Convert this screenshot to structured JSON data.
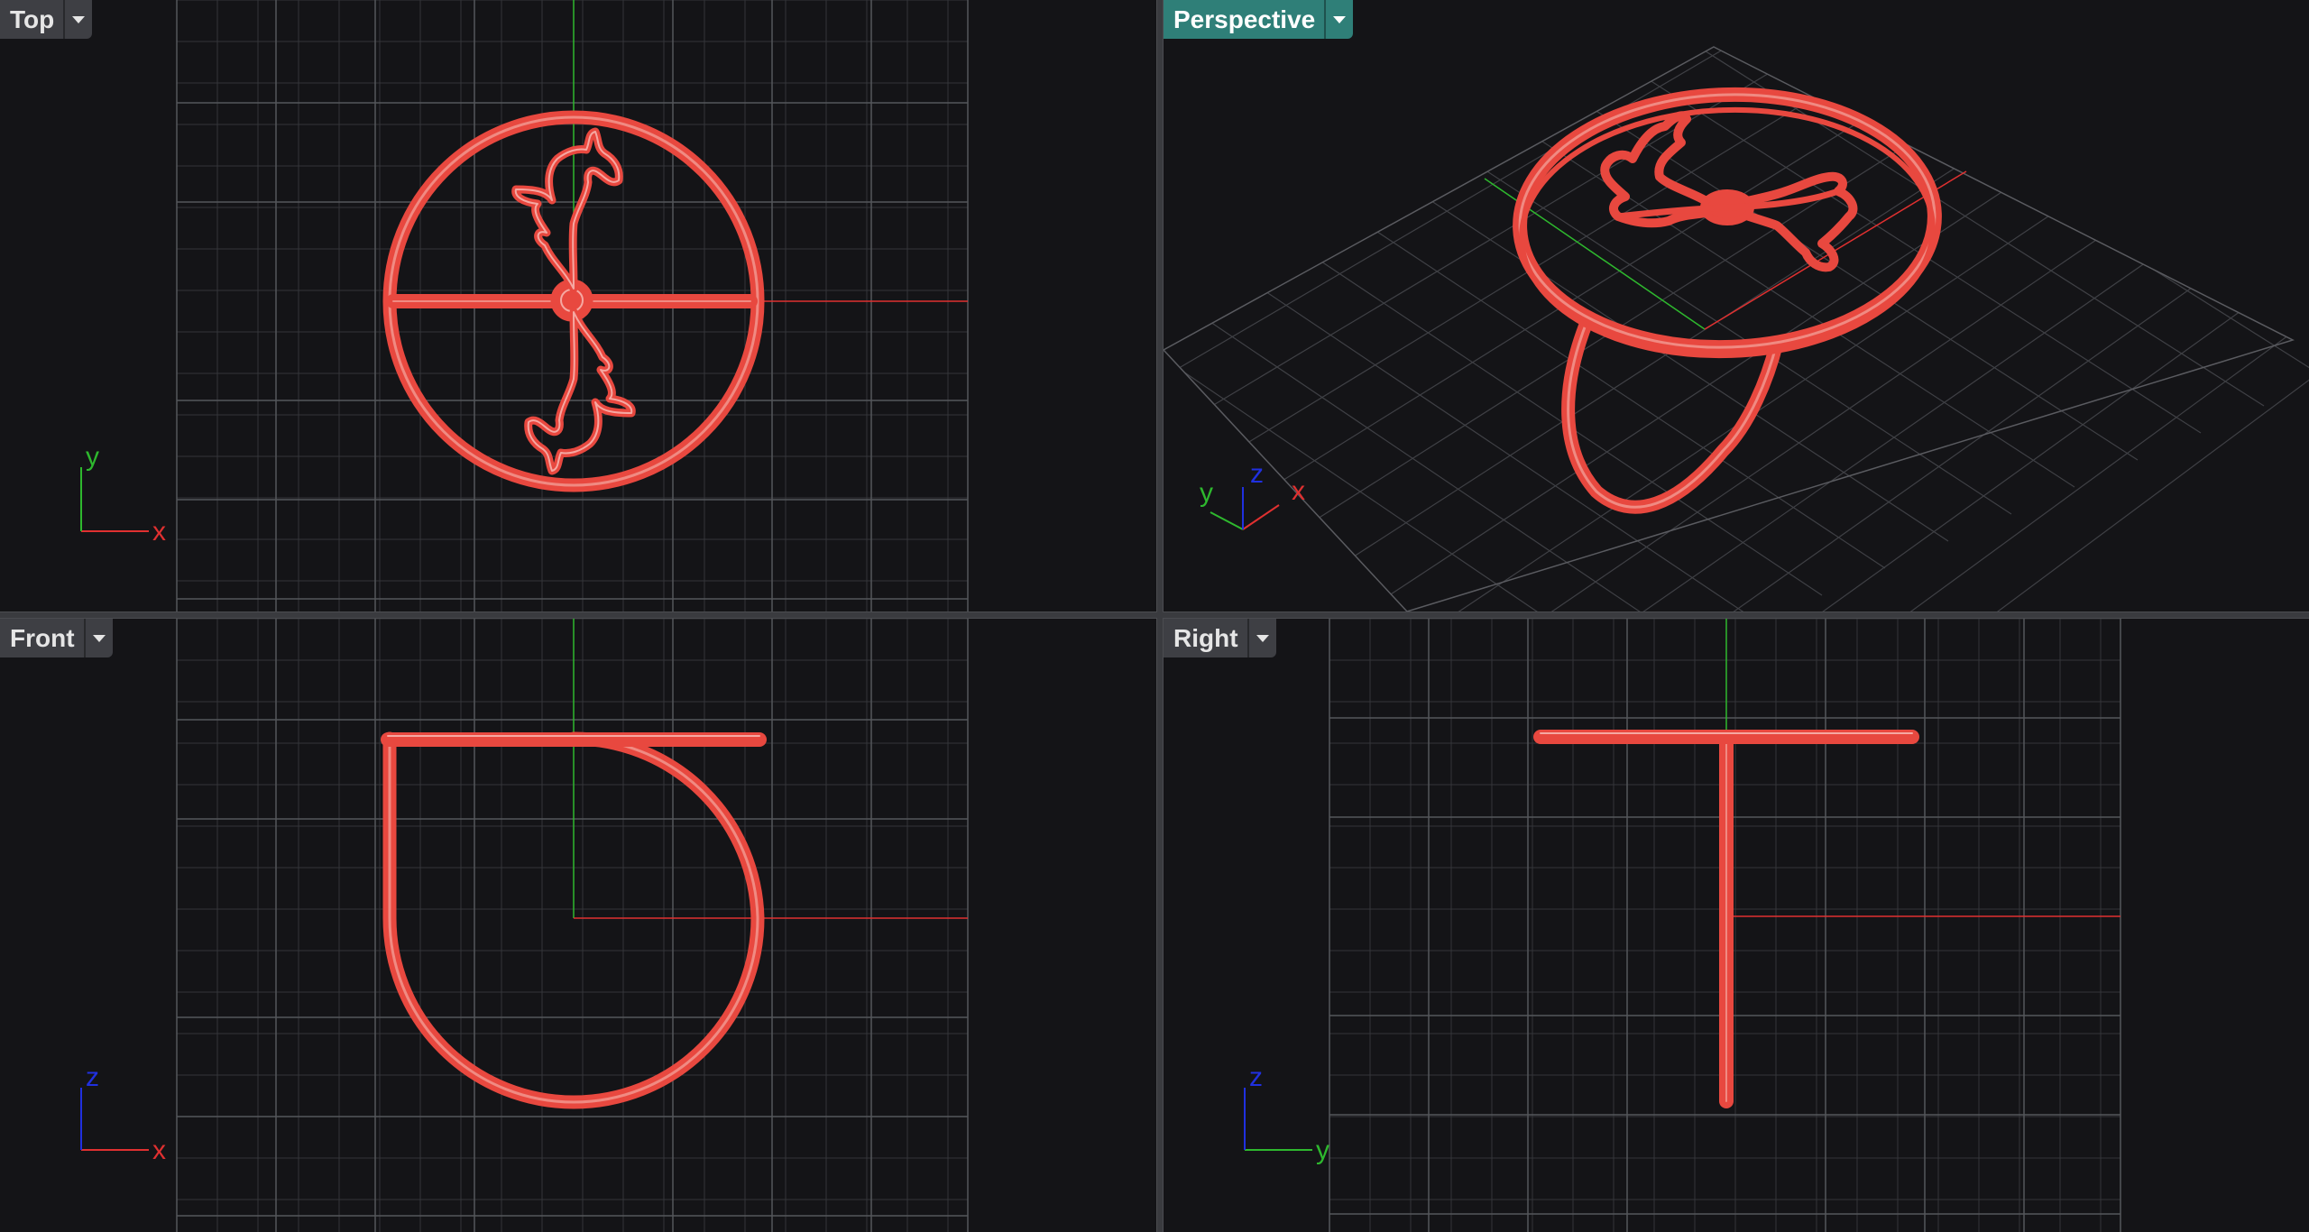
{
  "viewports": {
    "top": {
      "title": "Top"
    },
    "perspective": {
      "title": "Perspective"
    },
    "front": {
      "title": "Front"
    },
    "right": {
      "title": "Right"
    }
  },
  "axes": {
    "top": {
      "h": "x",
      "v": "y"
    },
    "front": {
      "h": "x",
      "v": "z"
    },
    "right": {
      "h": "y",
      "v": "z"
    },
    "perspective": {
      "a": "y",
      "b": "z",
      "c": "x"
    }
  },
  "colors": {
    "viewport_bg": "#141417",
    "grid": "#3c3d41",
    "grid_major": "#5a5b60",
    "x_axis": "#e03030",
    "y_axis": "#2eb82e",
    "z_axis": "#2030e0",
    "model": "#e8483f",
    "active_tab": "#2f7f78"
  }
}
